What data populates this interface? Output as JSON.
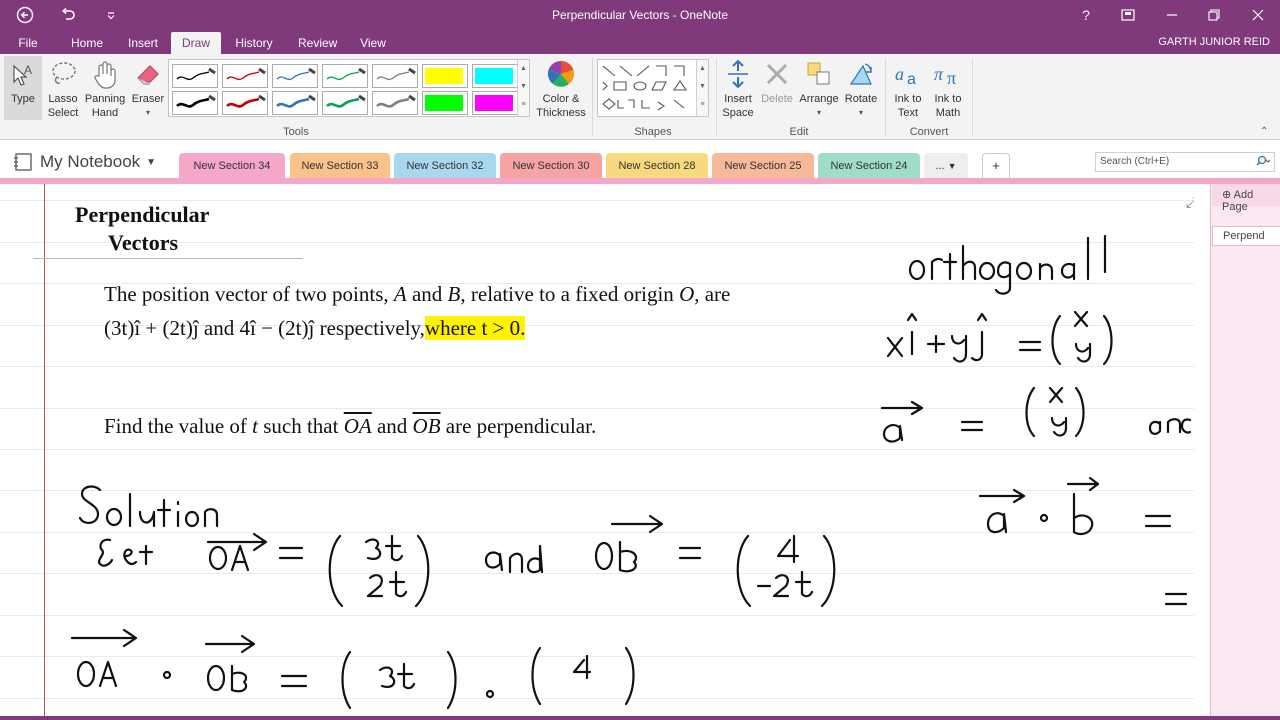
{
  "window": {
    "title": "Perpendicular Vectors - OneNote",
    "help": "?",
    "restore_glyph": "⧉",
    "min_glyph": "—",
    "max_glyph": "❐",
    "close_glyph": "✕"
  },
  "menu": {
    "tabs": [
      "File",
      "Home",
      "Insert",
      "Draw",
      "History",
      "Review",
      "View"
    ],
    "active": "Draw",
    "user": "GARTH JUNIOR REID"
  },
  "ribbon": {
    "type_label": "Type",
    "lasso_label": "Lasso Select",
    "panning_label": "Panning Hand",
    "eraser_label": "Eraser",
    "color_label": "Color & Thickness",
    "tools_group": "Tools",
    "shapes_group": "Shapes",
    "insert_space_label": "Insert Space",
    "delete_label": "Delete",
    "arrange_label": "Arrange",
    "rotate_label": "Rotate",
    "edit_group": "Edit",
    "ink_to_text_label": "Ink to Text",
    "ink_to_math_label": "Ink to Math",
    "convert_group": "Convert",
    "pen_colors": [
      "#000000",
      "#C00000",
      "#2E75B6",
      "#00A64F",
      "#7F7F7F",
      "#FFFF00",
      "#00FFFF",
      "#000000",
      "#C00000",
      "#2E75B6",
      "#00A64F",
      "#7F7F7F",
      "#00FF00",
      "#FF00FF"
    ]
  },
  "notebook": {
    "name": "My Notebook",
    "sections": [
      {
        "label": "New Section 34",
        "color": "#F4A7C9"
      },
      {
        "label": "New Section 33",
        "color": "#F9C28B"
      },
      {
        "label": "New Section 32",
        "color": "#A9D8EE"
      },
      {
        "label": "New Section 30",
        "color": "#F6A3A3"
      },
      {
        "label": "New Section 28",
        "color": "#F9D97F"
      },
      {
        "label": "New Section 25",
        "color": "#F8B99A"
      },
      {
        "label": "New Section 24",
        "color": "#9FDDC8"
      }
    ],
    "more": "...",
    "add": "+",
    "search_placeholder": "Search (Ctrl+E)"
  },
  "page": {
    "title_line1": "Perpendicular",
    "title_line2": "Vectors",
    "q1_a": "The position vector of two points,",
    "q1_A": "A",
    "q1_and1": "and",
    "q1_B": "B",
    "q1_b": ", relative to a fixed origin",
    "q1_O": "O",
    "q1_c": ", are",
    "q2_v1": "(3t)î + (2t)ĵ",
    "q2_and": "and",
    "q2_v2": "4î − (2t)ĵ",
    "q2_resp": "respectively,",
    "q2_where": "where t > 0.",
    "q3_a": "Find the value of",
    "q3_t": "t",
    "q3_b": "such that",
    "q3_OA": "OA",
    "q3_and": "and",
    "q3_OB": "OB",
    "q3_c": "are perpendicular."
  },
  "handwriting": {
    "right_word": "orthogonal",
    "solution": "Solution",
    "let": "Let",
    "oa_col": [
      "3t",
      "2t"
    ],
    "and": "and",
    "ob_col": [
      "4",
      "-2t"
    ],
    "right_partial": "an",
    "bottom_col_top_left": "3t",
    "bottom_col_top_right": "4"
  },
  "pages_panel": {
    "add_page": "Add Page",
    "page_item": "Perpend"
  }
}
